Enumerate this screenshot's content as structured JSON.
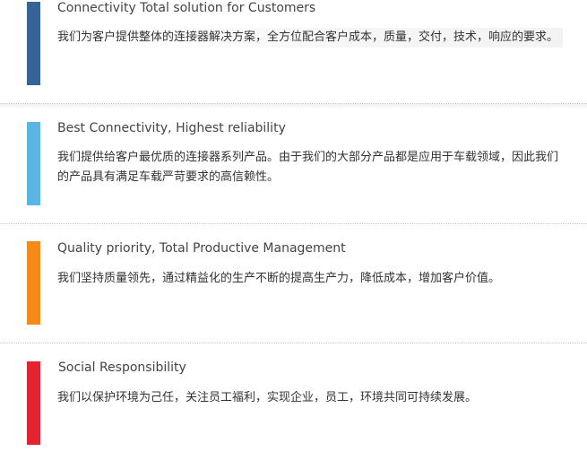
{
  "sections": [
    {
      "title": "Connectivity Total solution for Customers",
      "description": "我们为客户提供整体的连接器解决方案，全方位配合客户成本，质量，交付，技术，响应的要求。",
      "color": "#36649a"
    },
    {
      "title": "Best Connectivity, Highest reliability",
      "description": "我们提供给客户最优质的连接器系列产品。由于我们的大部分产品都是应用于车载领域，因此我们的产品具有满足车载严苛要求的高信赖性。",
      "color": "#5bb5e2"
    },
    {
      "title": "Quality priority, Total Productive Management",
      "description": "我们坚持质量领先，通过精益化的生产不断的提高生产力，降低成本，增加客户价值。",
      "color": "#f7891a"
    },
    {
      "title": "Social Responsibility",
      "description": "我们以保护环境为己任，关注员工福利，实现企业，员工，环境共同可持续发展。",
      "color": "#e52230"
    }
  ]
}
